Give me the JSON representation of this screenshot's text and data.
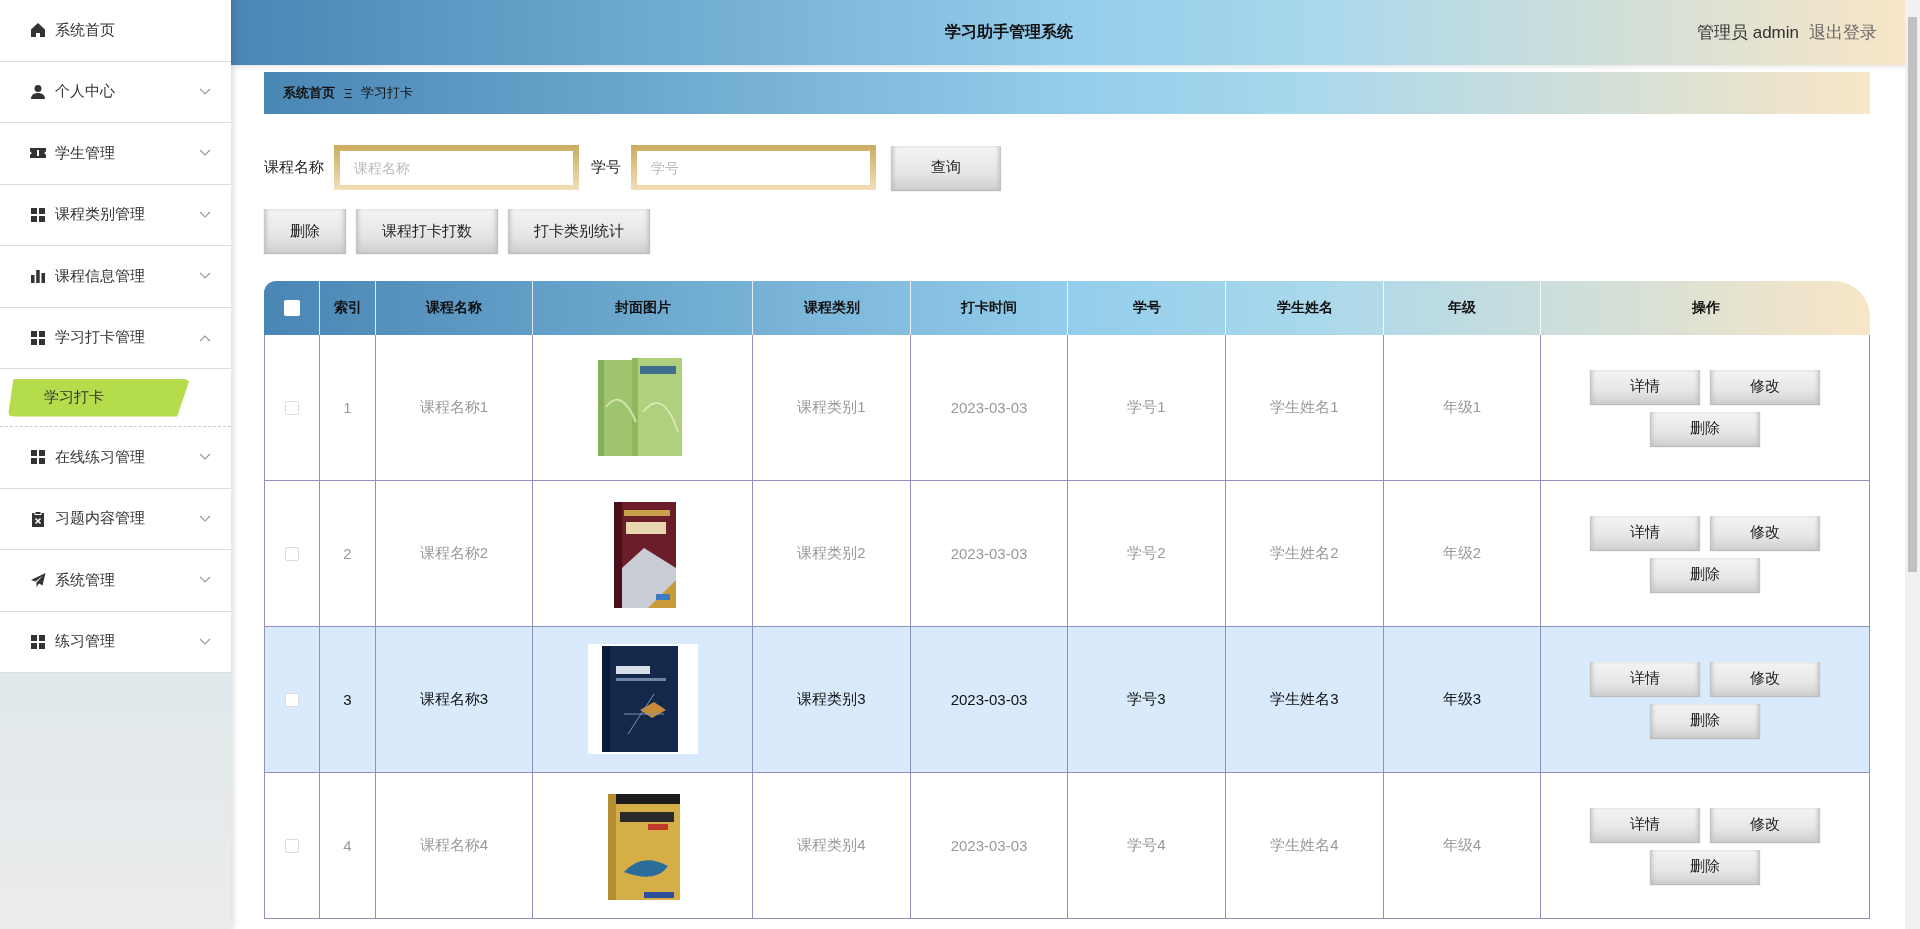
{
  "header": {
    "title": "学习助手管理系统",
    "user": "管理员 admin",
    "logout": "退出登录"
  },
  "sidebar": {
    "items": [
      {
        "label": "系统首页"
      },
      {
        "label": "个人中心",
        "expanded": false
      },
      {
        "label": "学生管理",
        "expanded": false
      },
      {
        "label": "课程类别管理",
        "expanded": false
      },
      {
        "label": "课程信息管理",
        "expanded": false
      },
      {
        "label": "学习打卡管理",
        "expanded": true,
        "children": [
          {
            "label": "学习打卡",
            "selected": true
          }
        ]
      },
      {
        "label": "在线练习管理",
        "expanded": false
      },
      {
        "label": "习题内容管理",
        "expanded": false
      },
      {
        "label": "系统管理",
        "expanded": false
      },
      {
        "label": "练习管理",
        "expanded": false
      }
    ]
  },
  "breadcrumb": {
    "home": "系统首页",
    "separator": "Ξ",
    "current": "学习打卡"
  },
  "search": {
    "fields": [
      {
        "label": "课程名称",
        "placeholder": "课程名称"
      },
      {
        "label": "学号",
        "placeholder": "学号"
      }
    ],
    "button": "查询"
  },
  "actions": [
    "删除",
    "课程打卡打数",
    "打卡类别统计"
  ],
  "table": {
    "header_checkbox": {
      "checked": false
    },
    "columns": [
      "索引",
      "课程名称",
      "封面图片",
      "课程类别",
      "打卡时间",
      "学号",
      "学生姓名",
      "年级",
      "操作"
    ],
    "rows": [
      {
        "selected": false,
        "checked": false,
        "index": "1",
        "course": "课程名称1",
        "cover": {
          "kind": "picture"
        },
        "category": "课程类别1",
        "time": "2023-03-03",
        "student_id": "学号1",
        "student_name": "学生姓名1",
        "grade": "年级1",
        "buttons": [
          "详情",
          "修改",
          "删除"
        ]
      },
      {
        "selected": false,
        "checked": false,
        "index": "2",
        "course": "课程名称2",
        "cover": {
          "kind": "picture"
        },
        "category": "课程类别2",
        "time": "2023-03-03",
        "student_id": "学号2",
        "student_name": "学生姓名2",
        "grade": "年级2",
        "buttons": [
          "详情",
          "修改",
          "删除"
        ]
      },
      {
        "selected": true,
        "checked": false,
        "index": "3",
        "course": "课程名称3",
        "cover": {
          "kind": "picture"
        },
        "category": "课程类别3",
        "time": "2023-03-03",
        "student_id": "学号3",
        "student_name": "学生姓名3",
        "grade": "年级3",
        "buttons": [
          "详情",
          "修改",
          "删除"
        ]
      },
      {
        "selected": false,
        "checked": false,
        "index": "4",
        "course": "课程名称4",
        "cover": {
          "kind": "picture"
        },
        "category": "课程类别4",
        "time": "2023-03-03",
        "student_id": "学号4",
        "student_name": "学生姓名4",
        "grade": "年级4",
        "buttons": [
          "详情",
          "修改",
          "删除"
        ]
      }
    ]
  }
}
